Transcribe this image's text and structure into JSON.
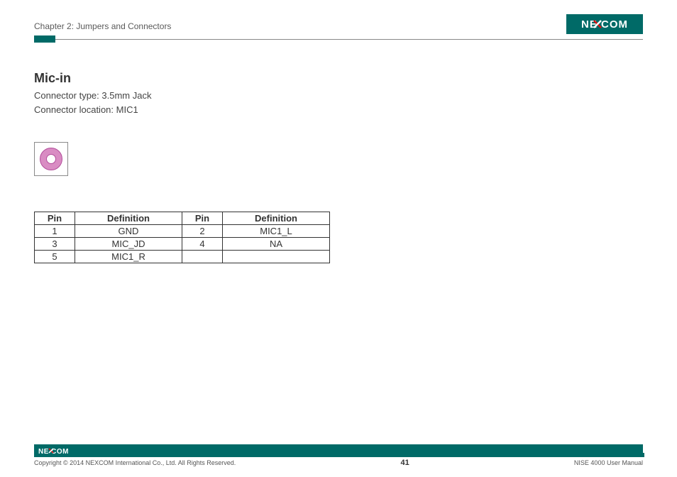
{
  "header": {
    "chapter": "Chapter 2: Jumpers and Connectors",
    "brand": "NEXCOM"
  },
  "section": {
    "title": "Mic-in",
    "connector_type_label": "Connector type: 3.5mm Jack",
    "connector_location_label": "Connector location: MIC1"
  },
  "table": {
    "headers": {
      "pin": "Pin",
      "def": "Definition"
    },
    "rows": [
      {
        "pin_a": "1",
        "def_a": "GND",
        "pin_b": "2",
        "def_b": "MIC1_L"
      },
      {
        "pin_a": "3",
        "def_a": "MIC_JD",
        "pin_b": "4",
        "def_b": "NA"
      },
      {
        "pin_a": "5",
        "def_a": "MIC1_R",
        "pin_b": "",
        "def_b": ""
      }
    ]
  },
  "footer": {
    "copyright": "Copyright © 2014 NEXCOM International Co., Ltd. All Rights Reserved.",
    "page": "41",
    "manual": "NISE 4000 User Manual"
  }
}
